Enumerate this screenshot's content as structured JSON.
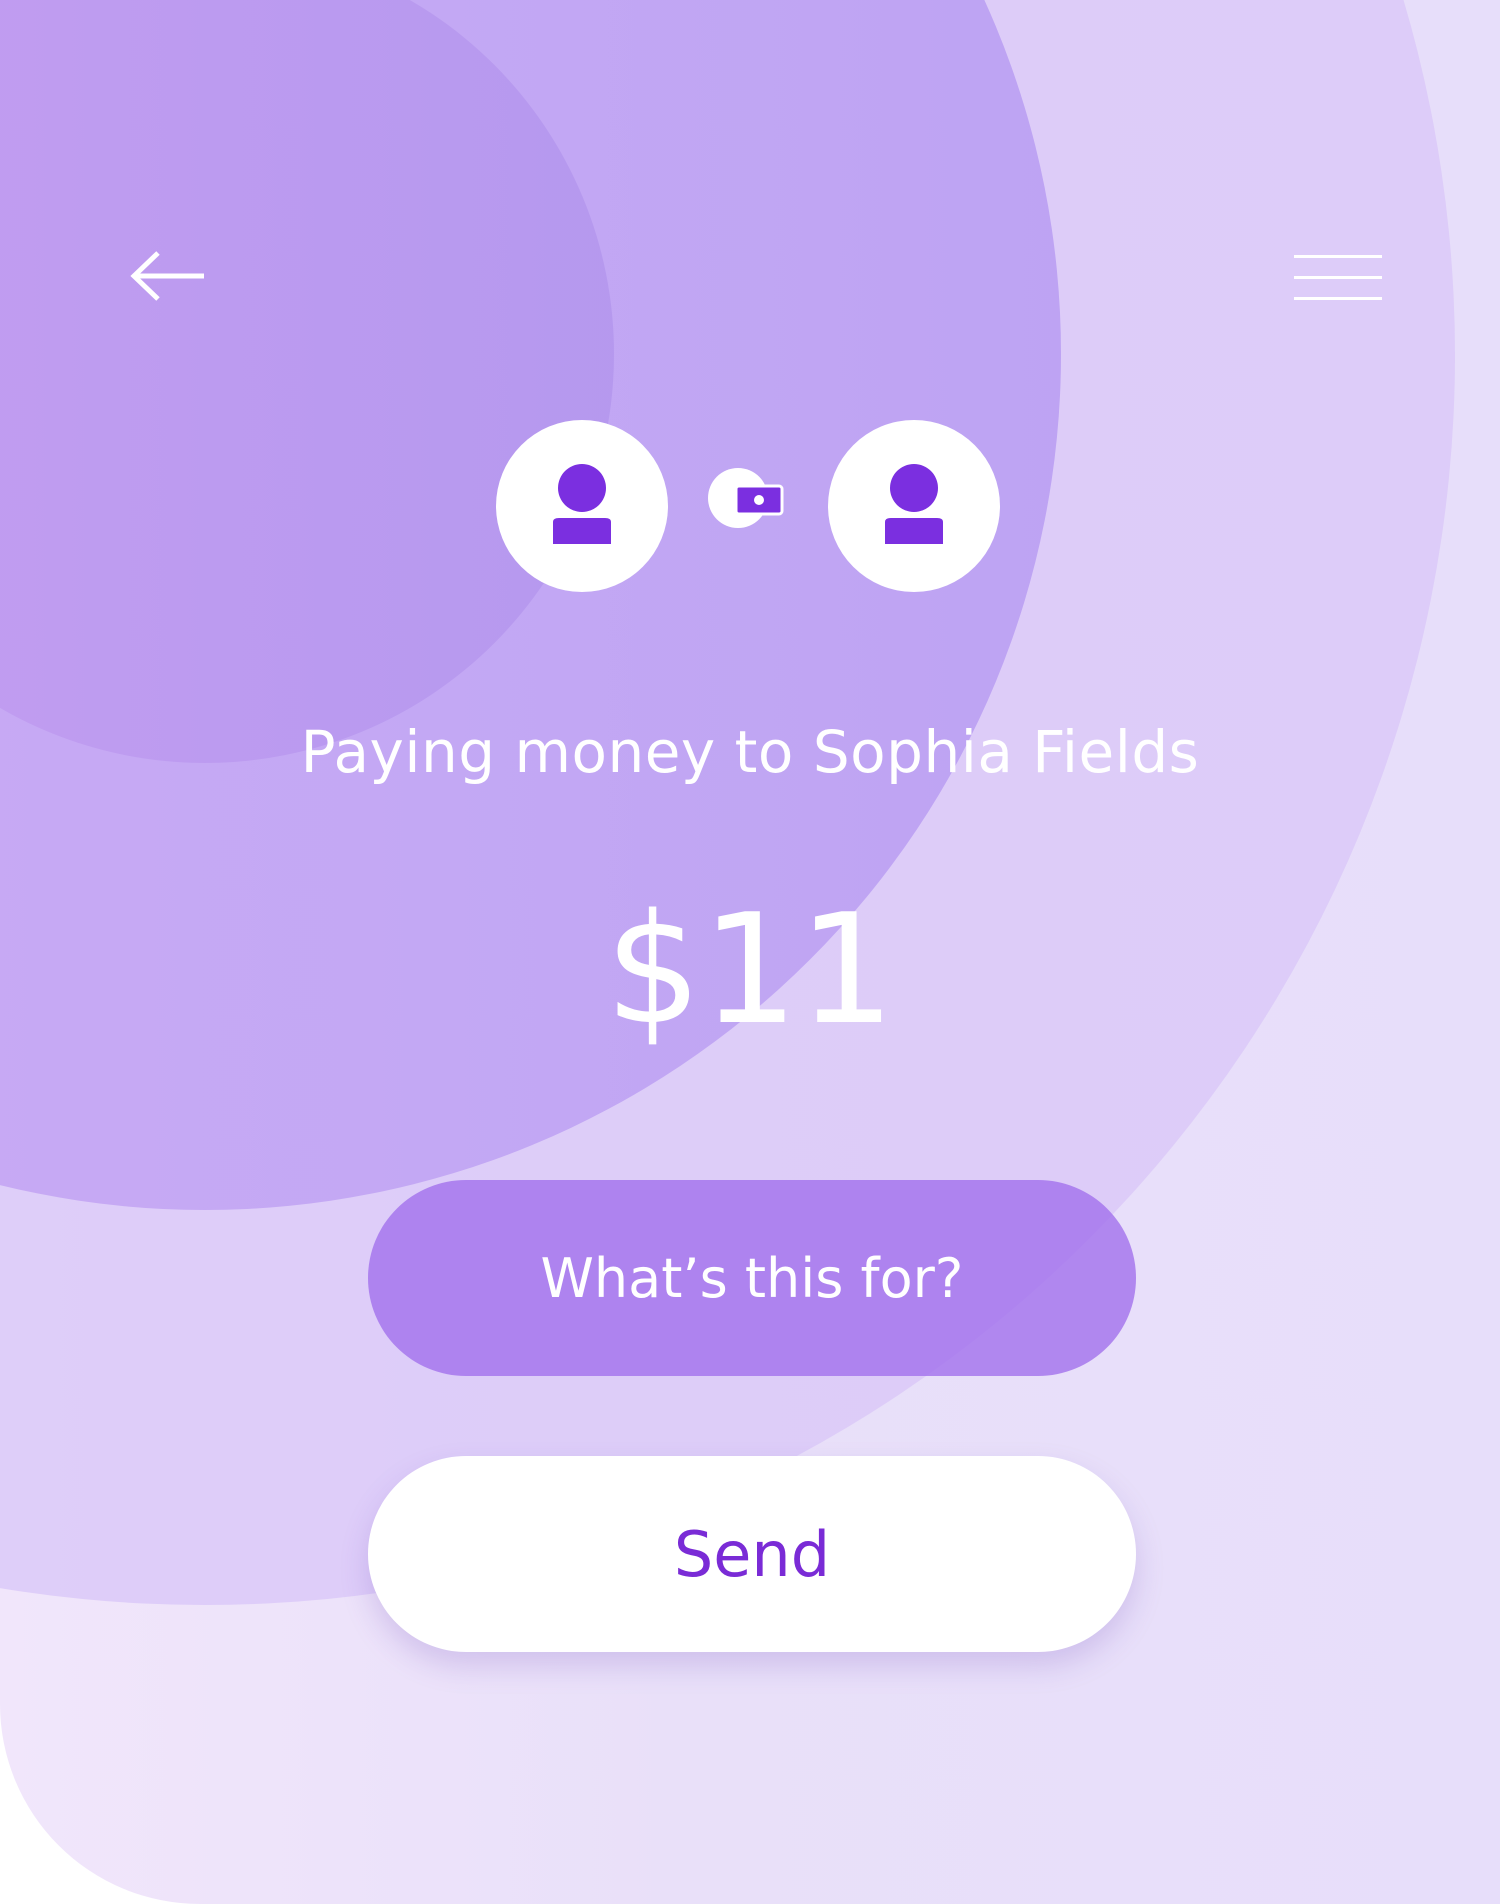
{
  "header": {
    "back_icon": "arrow-left-icon",
    "menu_icon": "hamburger-menu-icon"
  },
  "transfer": {
    "sender_avatar_icon": "user-icon",
    "recipient_avatar_icon": "user-icon",
    "transfer_icon": "wallet-icon",
    "paying_text": "Paying money to Sophia Fields",
    "amount": "$11"
  },
  "actions": {
    "note_label": "What’s this for?",
    "send_label": "Send"
  },
  "colors": {
    "accent": "#7a2bd6",
    "avatar_glyph": "#7b2fe0",
    "note_pill": "#a06eec",
    "background": "#e9e0f9"
  }
}
